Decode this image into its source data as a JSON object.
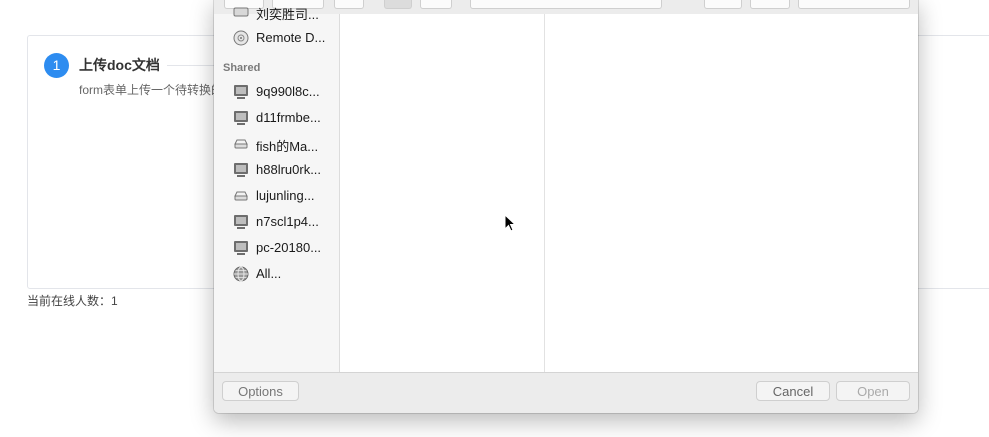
{
  "page": {
    "step_number": "1",
    "step_title": "上传doc文档",
    "step_desc": "form表单上传一个待转换的",
    "online_count": "当前在线人数：1"
  },
  "dialog": {
    "sidebar": {
      "top_items": [
        {
          "label": "刘奕胜司...",
          "icon": "drive-icon"
        },
        {
          "label": "Remote D...",
          "icon": "disc-icon"
        }
      ],
      "shared_heading": "Shared",
      "shared_items": [
        {
          "label": "9q990l8c...",
          "icon": "monitor-icon"
        },
        {
          "label": "d11frmbe...",
          "icon": "monitor-icon"
        },
        {
          "label": "fish的Ma...",
          "icon": "server-icon"
        },
        {
          "label": "h88lru0rk...",
          "icon": "monitor-icon"
        },
        {
          "label": "lujunling...",
          "icon": "server-icon"
        },
        {
          "label": "n7scl1p4...",
          "icon": "monitor-icon"
        },
        {
          "label": "pc-20180...",
          "icon": "monitor-icon"
        },
        {
          "label": "All...",
          "icon": "network-globe-icon"
        }
      ]
    },
    "buttons": {
      "options": "Options",
      "cancel": "Cancel",
      "open": "Open"
    }
  },
  "colors": {
    "accent": "#2d8cf0",
    "dialog_chrome": "#ececec",
    "sidebar_bg": "#f6f6f6"
  }
}
